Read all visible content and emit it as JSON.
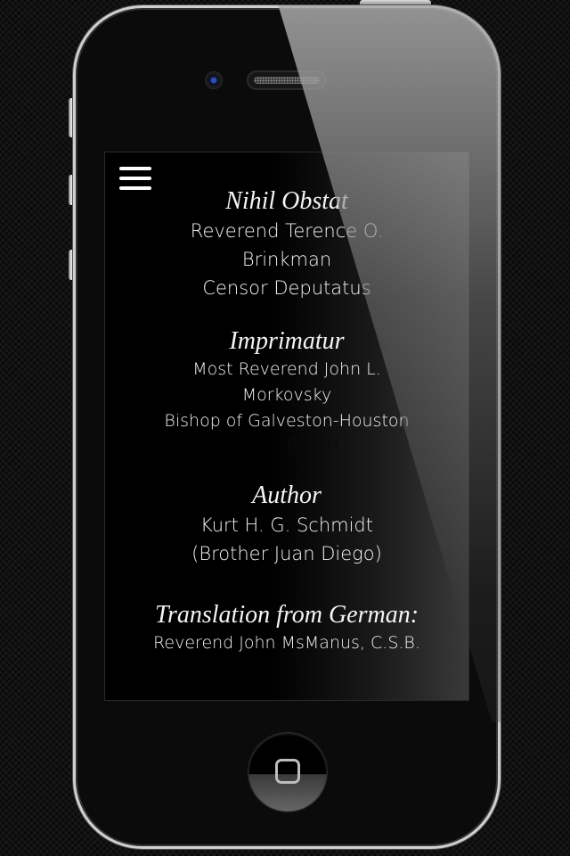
{
  "app": {
    "menu_icon": "hamburger-menu-icon"
  },
  "sections": [
    {
      "heading": "Nihil Obstat",
      "lines": [
        "Reverend Terence O.",
        "Brinkman",
        "Censor Deputatus"
      ]
    },
    {
      "heading": "Imprimatur",
      "lines": [
        "Most Reverend John L.",
        "Morkovsky",
        "Bishop of Galveston-Houston"
      ],
      "date_partial": "0, 1983"
    },
    {
      "heading": "Author",
      "lines": [
        "Kurt H. G. Schmidt",
        "(Brother Juan Diego)"
      ]
    },
    {
      "heading": "Translation from German:",
      "lines": [
        "Reverend John MsManus, C.S.B."
      ]
    }
  ],
  "device": {
    "home_button_icon": "home-square-icon"
  }
}
